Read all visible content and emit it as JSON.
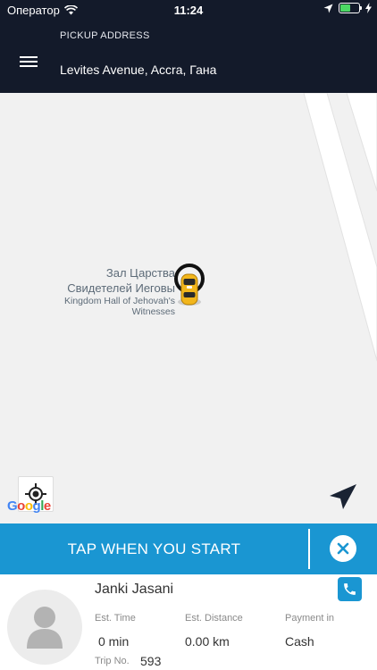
{
  "status_bar": {
    "carrier": "Оператор",
    "time": "11:24",
    "battery_level": 0.55,
    "icons": [
      "wifi-icon",
      "location-arrow-icon",
      "battery-icon",
      "charging-bolt-icon"
    ]
  },
  "header": {
    "menu_icon": "hamburger-menu-icon",
    "pickup_label": "PICKUP ADDRESS",
    "pickup_address": "Levites Avenue, Accra, Гана"
  },
  "map": {
    "poi_name_ru": "Зал Царства Свидетелей Иеговы",
    "poi_name_en": "Kingdom Hall of Jehovah's Witnesses",
    "google_logo": "Google",
    "marker_icon": "taxi-car-marker-icon",
    "locate_icon": "my-location-icon",
    "navigate_icon": "navigation-arrow-icon"
  },
  "action_bar": {
    "label": "TAP WHEN YOU START",
    "cancel_icon": "close-icon",
    "color": "#1a96d2"
  },
  "driver": {
    "name": "Janki Jasani",
    "phone_icon": "phone-icon",
    "avatar_icon": "user-avatar-icon",
    "est_time_label": "Est. Time",
    "est_time_value": "0 min",
    "est_distance_label": "Est. Distance",
    "est_distance_value": "0.00 km",
    "payment_label": "Payment in",
    "payment_value": "Cash",
    "trip_no_label": "Trip No.",
    "trip_no_value": "593"
  },
  "colors": {
    "header_bg": "#131a2a",
    "accent": "#1a96d2",
    "marker_yellow": "#f2b61c"
  }
}
